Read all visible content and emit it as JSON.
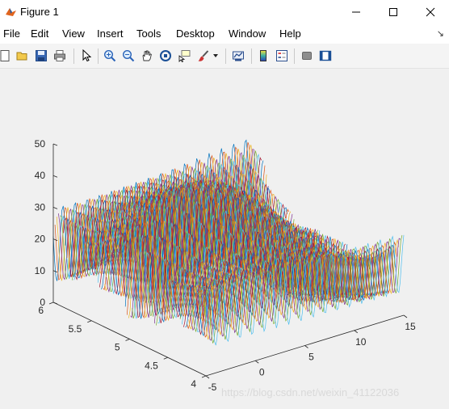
{
  "window": {
    "title": "Figure 1"
  },
  "menu": [
    "File",
    "Edit",
    "View",
    "Insert",
    "Tools",
    "Desktop",
    "Window",
    "Help"
  ],
  "toolbar": {
    "icons": [
      "new-figure-icon",
      "open-file-icon",
      "save-icon",
      "print-icon",
      "edit-plot-arrow-icon",
      "zoom-in-icon",
      "zoom-out-icon",
      "pan-hand-icon",
      "rotate-3d-icon",
      "data-cursor-icon",
      "brush-icon",
      "brush-dropdown-icon",
      "link-plot-icon",
      "colorbar-icon",
      "legend-icon",
      "hide-plot-tools-icon",
      "show-plot-tools-icon"
    ]
  },
  "watermark": "https://blog.csdn.net/weixin_41122036",
  "chart_data": {
    "type": "surface",
    "title": "",
    "xlabel": "",
    "ylabel": "",
    "zlabel": "",
    "x_ticks": [
      "-5",
      "0",
      "5",
      "10",
      "15"
    ],
    "y_ticks": [
      "4",
      "4.5",
      "5",
      "5.5",
      "6"
    ],
    "z_ticks": [
      "0",
      "10",
      "20",
      "30",
      "40",
      "50"
    ],
    "xlim": [
      -5,
      15
    ],
    "ylim": [
      4,
      6
    ],
    "zlim": [
      0,
      50
    ],
    "grid": false,
    "colororder": [
      "#0072BD",
      "#D95319",
      "#EDB120",
      "#7E2F8E",
      "#77AC30",
      "#4DBEEE",
      "#A2142F"
    ],
    "description_values": {
      "z_range_approx": [
        0,
        55
      ],
      "oscillation": "dense sinusoidal ripples along x"
    }
  }
}
